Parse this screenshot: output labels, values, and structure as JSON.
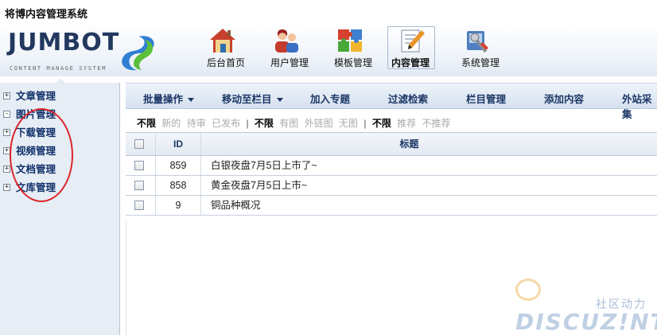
{
  "app": {
    "title": "将博内容管理系统",
    "logo_text": "JUMBOT",
    "logo_subtitle": "CONTENT MANAGE SYSTEM"
  },
  "nav": [
    {
      "label": "后台首页",
      "icon": "house-icon",
      "active": false
    },
    {
      "label": "用户管理",
      "icon": "users-icon",
      "active": false
    },
    {
      "label": "模板管理",
      "icon": "puzzle-icon",
      "active": false
    },
    {
      "label": "内容管理",
      "icon": "edit-document-icon",
      "active": true
    },
    {
      "label": "系统管理",
      "icon": "tools-icon",
      "active": false
    }
  ],
  "sidebar": {
    "items": [
      {
        "label": "文章管理",
        "expander": "+"
      },
      {
        "label": "图片管理",
        "expander": "-"
      },
      {
        "label": "下载管理",
        "expander": "+"
      },
      {
        "label": "视频管理",
        "expander": "+"
      },
      {
        "label": "文档管理",
        "expander": "+"
      },
      {
        "label": "文库管理",
        "expander": "+"
      }
    ]
  },
  "toolbar": {
    "items": [
      {
        "label": "批量操作",
        "dropdown": true
      },
      {
        "label": "移动至栏目",
        "dropdown": true
      },
      {
        "label": "加入专题",
        "dropdown": false
      },
      {
        "label": "过滤检索",
        "dropdown": false
      },
      {
        "label": "栏目管理",
        "dropdown": false
      },
      {
        "label": "添加内容",
        "dropdown": false
      },
      {
        "label": "外站采集",
        "dropdown": false
      }
    ]
  },
  "filters": {
    "group1": [
      "不限",
      "新的",
      "待审",
      "已发布"
    ],
    "group2": [
      "不限",
      "有图",
      "外链图",
      "无图"
    ],
    "group3": [
      "不限",
      "推荐",
      "不推荐"
    ],
    "separator": "|"
  },
  "table": {
    "headers": {
      "id": "ID",
      "title": "标题"
    },
    "rows": [
      {
        "id": "859",
        "title": "白银夜盘7月5日上市了~"
      },
      {
        "id": "858",
        "title": "黄金夜盘7月5日上市~"
      },
      {
        "id": "9",
        "title": "铜品种概况"
      }
    ]
  },
  "watermark": {
    "sub": "社区动力",
    "main": "DISCUZ!NT"
  },
  "colors": {
    "accent": "#1b3665",
    "sidebar_bg": "#e7edf5",
    "annotation": "#d9262b"
  }
}
